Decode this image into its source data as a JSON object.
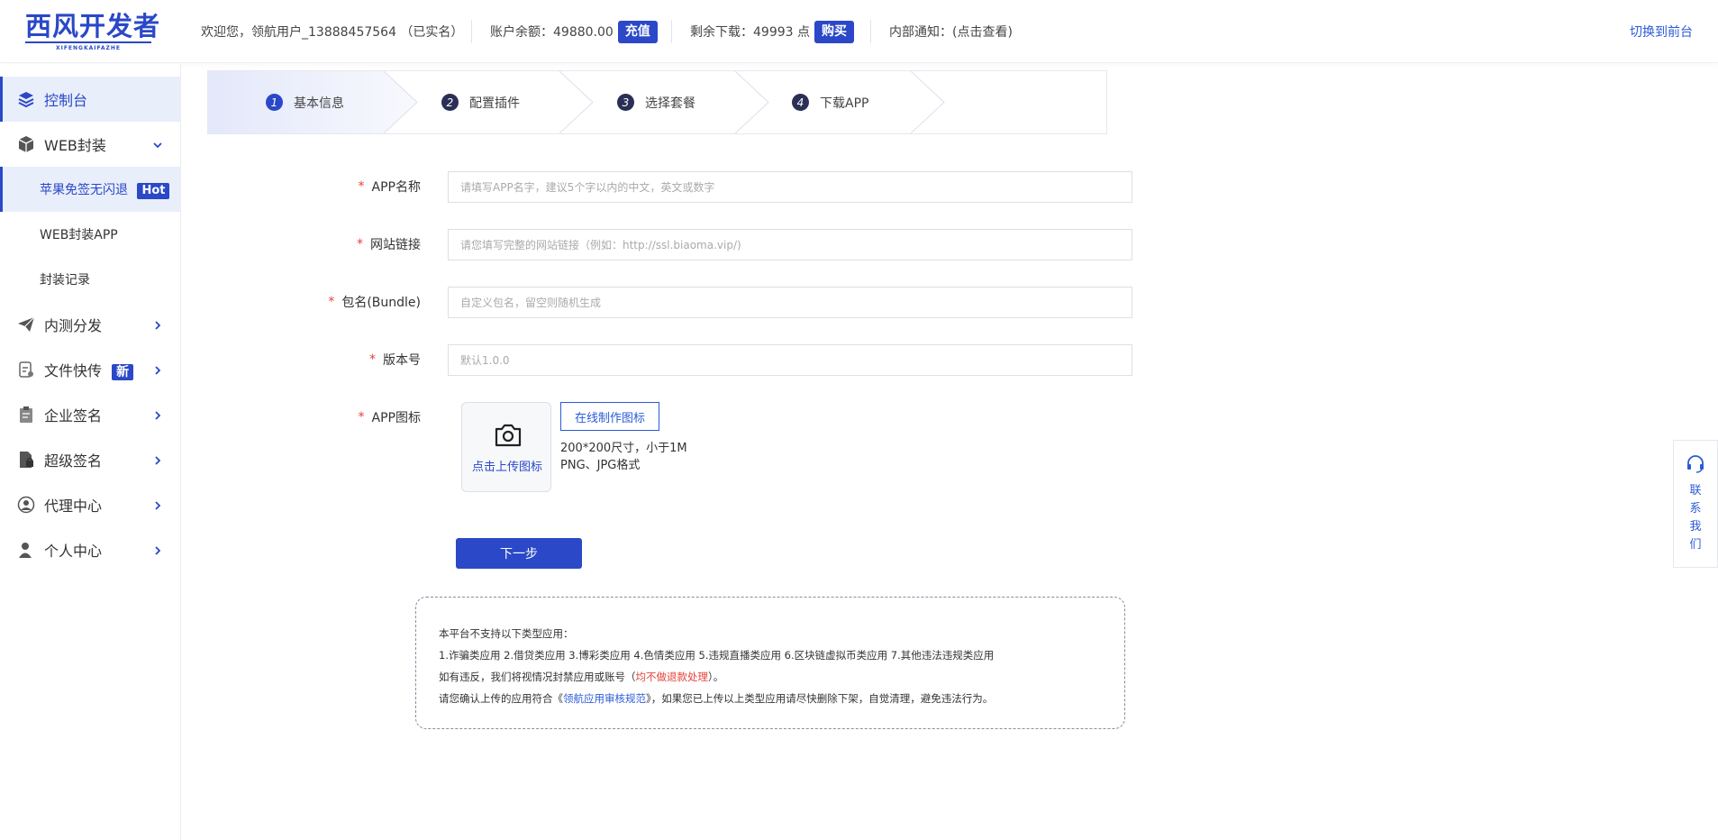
{
  "brand": {
    "logo_text": "西风开发者",
    "logo_sub": "XIFENGKAIFAZHE",
    "color": "#2a48c7"
  },
  "header": {
    "welcome": "欢迎您，领航用户_13888457564 （已实名）",
    "balance_label": "账户余额：49880.00",
    "recharge": "充值",
    "downloads_label": "剩余下载：49993 点",
    "buy": "购买",
    "notice": "内部通知：(点击查看)",
    "switch": "切换到前台"
  },
  "sidebar": {
    "items": [
      {
        "label": "控制台",
        "icon": "layers-icon"
      },
      {
        "label": "WEB封装",
        "icon": "box-icon"
      },
      {
        "label": "内测分发",
        "icon": "paper-plane-icon"
      },
      {
        "label": "文件快传",
        "icon": "file-transfer-icon",
        "badge": "新"
      },
      {
        "label": "企业签名",
        "icon": "clipboard-icon"
      },
      {
        "label": "超级签名",
        "icon": "document-lock-icon"
      },
      {
        "label": "代理中心",
        "icon": "agent-icon"
      },
      {
        "label": "个人中心",
        "icon": "user-icon"
      }
    ],
    "sub_items": [
      {
        "label": "苹果免签无闪退",
        "badge": "Hot"
      },
      {
        "label": "WEB封装APP"
      },
      {
        "label": "封装记录"
      }
    ]
  },
  "steps": [
    {
      "num": "1",
      "label": "基本信息"
    },
    {
      "num": "2",
      "label": "配置插件"
    },
    {
      "num": "3",
      "label": "选择套餐"
    },
    {
      "num": "4",
      "label": "下载APP"
    }
  ],
  "form": {
    "req": "*",
    "app_name": {
      "label": "APP名称",
      "placeholder": "请填写APP名字，建议5个字以内的中文，英文或数字"
    },
    "site_link": {
      "label": "网站链接",
      "placeholder": "请您填写完整的网站链接（例如：http://ssl.biaoma.vip/)"
    },
    "bundle": {
      "label": "包名(Bundle)",
      "placeholder": "自定义包名，留空则随机生成"
    },
    "version": {
      "label": "版本号",
      "placeholder": "默认1.0.0"
    },
    "icon": {
      "label": "APP图标",
      "upload": "点击上传图标",
      "online": "在线制作图标",
      "hint1": "200*200尺寸，小于1M",
      "hint2": "PNG、JPG格式"
    },
    "next": "下一步"
  },
  "notice": {
    "line1": "本平台不支持以下类型应用：",
    "line2": "1.诈骗类应用 2.借贷类应用 3.博彩类应用 4.色情类应用 5.违规直播类应用 6.区块链虚拟币类应用 7.其他违法违规类应用",
    "line3_a": "如有违反，我们将视情况封禁应用或账号（",
    "line3_red": "均不做退款处理",
    "line3_b": "）。",
    "line4_a": "请您确认上传的应用符合《",
    "line4_link": "领航应用审核规范",
    "line4_b": "》，如果您已上传以上类型应用请尽快删除下架，自觉清理，避免违法行为。"
  },
  "contact": {
    "chars": [
      "联",
      "系",
      "我",
      "们"
    ],
    "icon": "headset-icon"
  }
}
